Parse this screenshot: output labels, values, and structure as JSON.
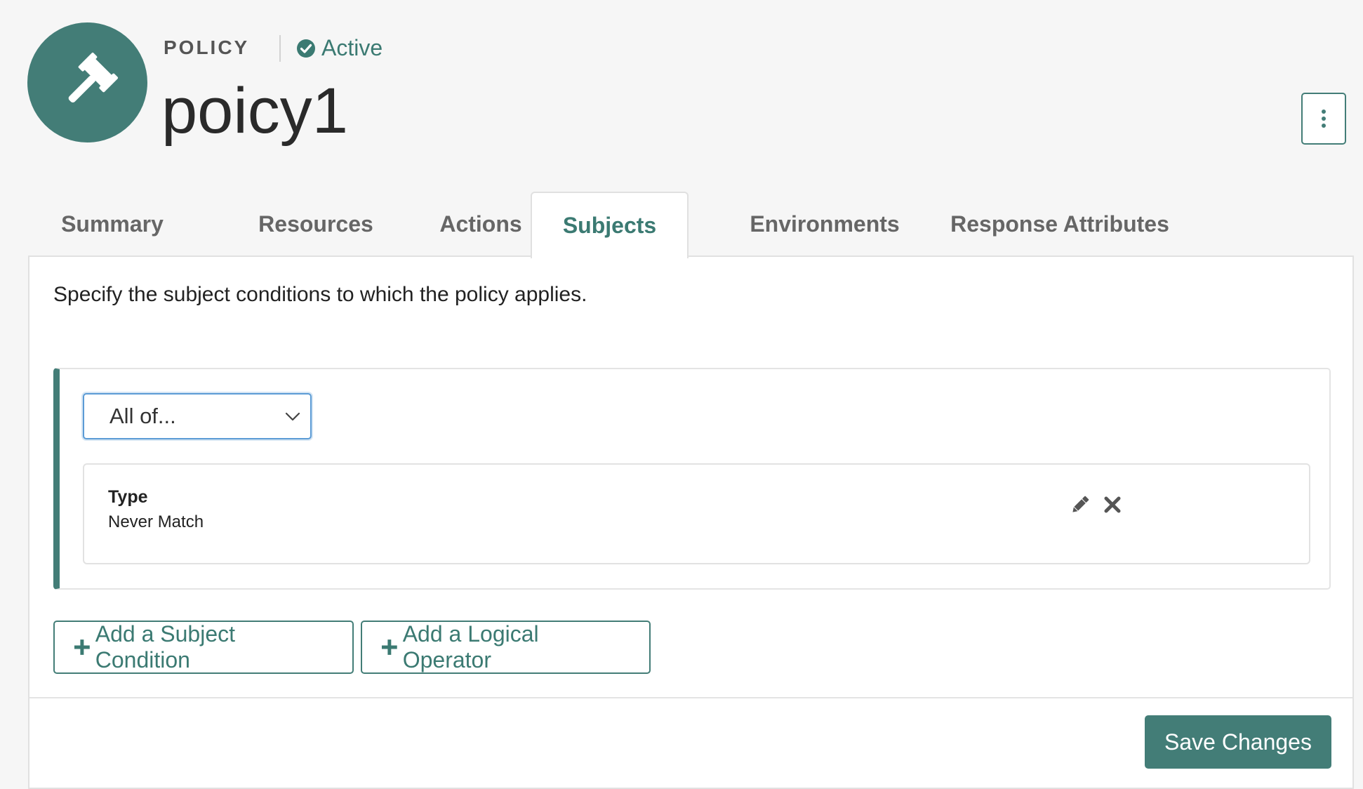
{
  "header": {
    "kind_label": "POLICY",
    "status_label": "Active",
    "policy_name": "poicy1",
    "logo_icon": "gavel-icon",
    "more_icon": "kebab-menu-icon"
  },
  "tabs": [
    {
      "label": "Summary",
      "active": false
    },
    {
      "label": "Resources",
      "active": false
    },
    {
      "label": "Actions",
      "active": false
    },
    {
      "label": "Subjects",
      "active": true
    },
    {
      "label": "Environments",
      "active": false
    },
    {
      "label": "Response Attributes",
      "active": false
    }
  ],
  "subjects": {
    "intro_text": "Specify the subject conditions to which the policy applies.",
    "operator_select": {
      "value": "All of..."
    },
    "condition": {
      "label": "Type",
      "value": "Never Match",
      "edit_icon": "pencil-icon",
      "remove_icon": "close-icon"
    },
    "add_condition_label": "Add a Subject Condition",
    "add_operator_label": "Add a Logical Operator"
  },
  "footer": {
    "save_label": "Save Changes"
  },
  "colors": {
    "accent": "#437d77",
    "accent_text": "#3b7a72",
    "background": "#f6f6f6",
    "focus_border": "#5b9bd5"
  }
}
